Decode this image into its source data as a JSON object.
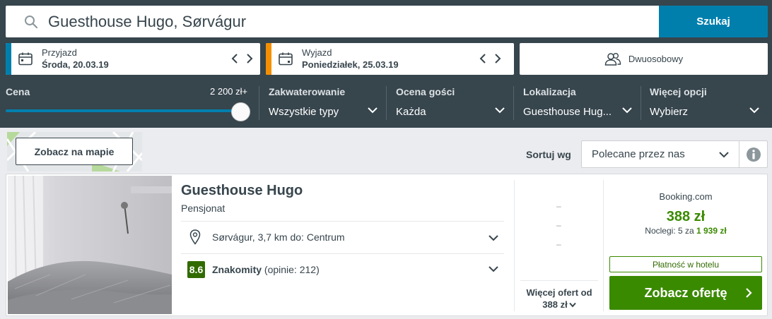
{
  "search": {
    "value": "Guesthouse Hugo, Sørvágur",
    "button_label": "Szukaj"
  },
  "dates": {
    "check_in": {
      "label": "Przyjazd",
      "value": "Środa, 20.03.19"
    },
    "check_out": {
      "label": "Wyjazd",
      "value": "Poniedziałek, 25.03.19"
    }
  },
  "room": {
    "label": "Dwuosobowy"
  },
  "filters": {
    "price": {
      "title": "Cena",
      "value": "2 200 zł+",
      "level": 1.0
    },
    "accommodation": {
      "title": "Zakwaterowanie",
      "value": "Wszystkie typy"
    },
    "guest_rating": {
      "title": "Ocena gości",
      "value": "Każda"
    },
    "location": {
      "title": "Lokalizacja",
      "value": "Guesthouse Hug..."
    },
    "more": {
      "title": "Więcej opcji",
      "value": "Wybierz"
    }
  },
  "map": {
    "button_label": "Zobacz na mapie"
  },
  "sort": {
    "label": "Sortuj wg",
    "value": "Polecane przez nas"
  },
  "result": {
    "name": "Guesthouse Hugo",
    "type": "Pensjonat",
    "location": "Sørvágur, 3,7 km do: Centrum",
    "rating_score": "8.6",
    "rating_word": "Znakomity",
    "rating_count": " (opinie: 212)",
    "dashes": [
      "–",
      "–",
      "–"
    ],
    "more_offers_line1": "Więcej ofert od",
    "more_offers_line2": "388 zł",
    "provider": "Booking.com",
    "price": "388 zł",
    "nights_prefix": "Noclegi: 5 za ",
    "nights_total": "1 939 zł",
    "payment_badge": "Płatność w hotelu",
    "deal_button": "Zobacz ofertę"
  },
  "colors": {
    "header_bg": "#37454d",
    "accent_blue": "#007fad",
    "accent_orange": "#f48f00",
    "deal_green": "#3a8a00",
    "rating_green": "#316b00"
  }
}
